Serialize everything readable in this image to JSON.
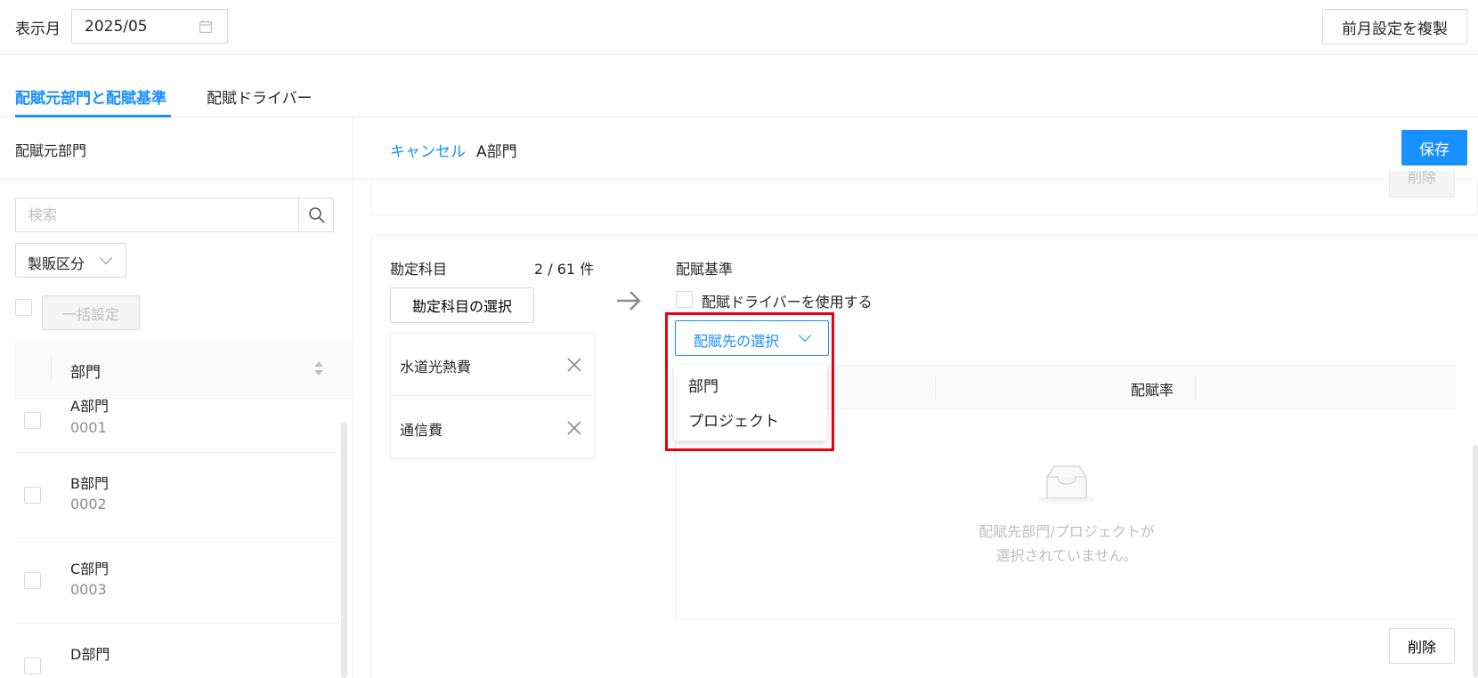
{
  "header": {
    "month_label": "表示月",
    "month_value": "2025/05",
    "copy_button": "前月設定を複製"
  },
  "tabs": [
    {
      "label": "配賦元部門と配賦基準",
      "active": true
    },
    {
      "label": "配賦ドライバー",
      "active": false
    }
  ],
  "left_panel": {
    "title": "配賦元部門",
    "search_placeholder": "検索",
    "filter_label": "製販区分",
    "bulk_button": "一括設定",
    "column_header": "部門",
    "rows": [
      {
        "name": "A部門",
        "code": "0001"
      },
      {
        "name": "B部門",
        "code": "0002"
      },
      {
        "name": "C部門",
        "code": "0003"
      },
      {
        "name": "D部門",
        "code": ""
      }
    ]
  },
  "right_panel": {
    "cancel_link": "キャンセル",
    "department": "A部門",
    "save_button": "保存",
    "prev_delete_button": "削除",
    "account_label": "勘定科目",
    "account_count": "2 / 61 件",
    "account_select_button": "勘定科目の選択",
    "accounts": [
      "水道光熱費",
      "通信費"
    ],
    "basis_label": "配賦基準",
    "driver_checkbox_label": "配賦ドライバーを使用する",
    "dest_button": "配賦先の選択",
    "dest_menu": [
      "部門",
      "プロジェクト"
    ],
    "dest_table_rate_header": "配賦率",
    "empty_line1": "配賦先部門/プロジェクトが",
    "empty_line2": "選択されていません。",
    "delete_button": "削除"
  },
  "colors": {
    "primary": "#1890ff",
    "highlight": "#e60012"
  }
}
